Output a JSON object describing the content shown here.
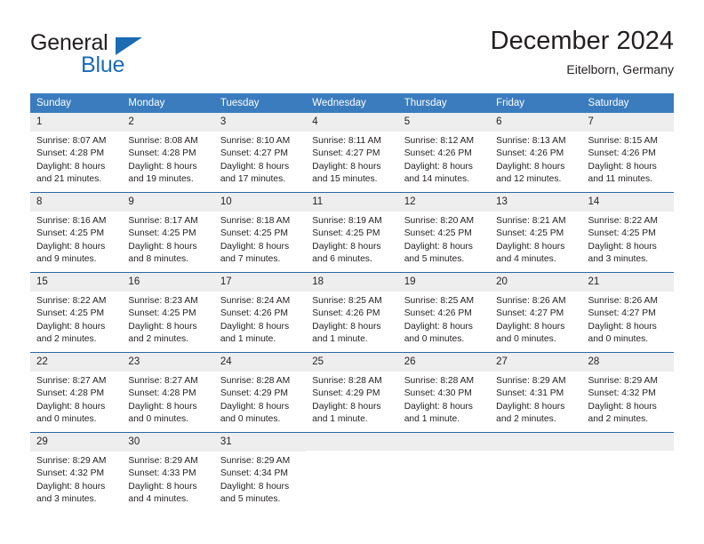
{
  "logo": {
    "word_top": "General",
    "word_bottom": "Blue",
    "triangle_icon": "triangle-icon",
    "brand_color": "#1b6cb3"
  },
  "header": {
    "title": "December 2024",
    "location": "Eitelborn, Germany"
  },
  "calendar": {
    "header_color": "#3a7cbe",
    "row_divider_color": "#2a69a8",
    "daynum_background": "#eeeeee",
    "weekday_headers": [
      "Sunday",
      "Monday",
      "Tuesday",
      "Wednesday",
      "Thursday",
      "Friday",
      "Saturday"
    ],
    "weeks": [
      [
        {
          "day": "1",
          "sunrise": "Sunrise: 8:07 AM",
          "sunset": "Sunset: 4:28 PM",
          "daylight_1": "Daylight: 8 hours",
          "daylight_2": "and 21 minutes."
        },
        {
          "day": "2",
          "sunrise": "Sunrise: 8:08 AM",
          "sunset": "Sunset: 4:28 PM",
          "daylight_1": "Daylight: 8 hours",
          "daylight_2": "and 19 minutes."
        },
        {
          "day": "3",
          "sunrise": "Sunrise: 8:10 AM",
          "sunset": "Sunset: 4:27 PM",
          "daylight_1": "Daylight: 8 hours",
          "daylight_2": "and 17 minutes."
        },
        {
          "day": "4",
          "sunrise": "Sunrise: 8:11 AM",
          "sunset": "Sunset: 4:27 PM",
          "daylight_1": "Daylight: 8 hours",
          "daylight_2": "and 15 minutes."
        },
        {
          "day": "5",
          "sunrise": "Sunrise: 8:12 AM",
          "sunset": "Sunset: 4:26 PM",
          "daylight_1": "Daylight: 8 hours",
          "daylight_2": "and 14 minutes."
        },
        {
          "day": "6",
          "sunrise": "Sunrise: 8:13 AM",
          "sunset": "Sunset: 4:26 PM",
          "daylight_1": "Daylight: 8 hours",
          "daylight_2": "and 12 minutes."
        },
        {
          "day": "7",
          "sunrise": "Sunrise: 8:15 AM",
          "sunset": "Sunset: 4:26 PM",
          "daylight_1": "Daylight: 8 hours",
          "daylight_2": "and 11 minutes."
        }
      ],
      [
        {
          "day": "8",
          "sunrise": "Sunrise: 8:16 AM",
          "sunset": "Sunset: 4:25 PM",
          "daylight_1": "Daylight: 8 hours",
          "daylight_2": "and 9 minutes."
        },
        {
          "day": "9",
          "sunrise": "Sunrise: 8:17 AM",
          "sunset": "Sunset: 4:25 PM",
          "daylight_1": "Daylight: 8 hours",
          "daylight_2": "and 8 minutes."
        },
        {
          "day": "10",
          "sunrise": "Sunrise: 8:18 AM",
          "sunset": "Sunset: 4:25 PM",
          "daylight_1": "Daylight: 8 hours",
          "daylight_2": "and 7 minutes."
        },
        {
          "day": "11",
          "sunrise": "Sunrise: 8:19 AM",
          "sunset": "Sunset: 4:25 PM",
          "daylight_1": "Daylight: 8 hours",
          "daylight_2": "and 6 minutes."
        },
        {
          "day": "12",
          "sunrise": "Sunrise: 8:20 AM",
          "sunset": "Sunset: 4:25 PM",
          "daylight_1": "Daylight: 8 hours",
          "daylight_2": "and 5 minutes."
        },
        {
          "day": "13",
          "sunrise": "Sunrise: 8:21 AM",
          "sunset": "Sunset: 4:25 PM",
          "daylight_1": "Daylight: 8 hours",
          "daylight_2": "and 4 minutes."
        },
        {
          "day": "14",
          "sunrise": "Sunrise: 8:22 AM",
          "sunset": "Sunset: 4:25 PM",
          "daylight_1": "Daylight: 8 hours",
          "daylight_2": "and 3 minutes."
        }
      ],
      [
        {
          "day": "15",
          "sunrise": "Sunrise: 8:22 AM",
          "sunset": "Sunset: 4:25 PM",
          "daylight_1": "Daylight: 8 hours",
          "daylight_2": "and 2 minutes."
        },
        {
          "day": "16",
          "sunrise": "Sunrise: 8:23 AM",
          "sunset": "Sunset: 4:25 PM",
          "daylight_1": "Daylight: 8 hours",
          "daylight_2": "and 2 minutes."
        },
        {
          "day": "17",
          "sunrise": "Sunrise: 8:24 AM",
          "sunset": "Sunset: 4:26 PM",
          "daylight_1": "Daylight: 8 hours",
          "daylight_2": "and 1 minute."
        },
        {
          "day": "18",
          "sunrise": "Sunrise: 8:25 AM",
          "sunset": "Sunset: 4:26 PM",
          "daylight_1": "Daylight: 8 hours",
          "daylight_2": "and 1 minute."
        },
        {
          "day": "19",
          "sunrise": "Sunrise: 8:25 AM",
          "sunset": "Sunset: 4:26 PM",
          "daylight_1": "Daylight: 8 hours",
          "daylight_2": "and 0 minutes."
        },
        {
          "day": "20",
          "sunrise": "Sunrise: 8:26 AM",
          "sunset": "Sunset: 4:27 PM",
          "daylight_1": "Daylight: 8 hours",
          "daylight_2": "and 0 minutes."
        },
        {
          "day": "21",
          "sunrise": "Sunrise: 8:26 AM",
          "sunset": "Sunset: 4:27 PM",
          "daylight_1": "Daylight: 8 hours",
          "daylight_2": "and 0 minutes."
        }
      ],
      [
        {
          "day": "22",
          "sunrise": "Sunrise: 8:27 AM",
          "sunset": "Sunset: 4:28 PM",
          "daylight_1": "Daylight: 8 hours",
          "daylight_2": "and 0 minutes."
        },
        {
          "day": "23",
          "sunrise": "Sunrise: 8:27 AM",
          "sunset": "Sunset: 4:28 PM",
          "daylight_1": "Daylight: 8 hours",
          "daylight_2": "and 0 minutes."
        },
        {
          "day": "24",
          "sunrise": "Sunrise: 8:28 AM",
          "sunset": "Sunset: 4:29 PM",
          "daylight_1": "Daylight: 8 hours",
          "daylight_2": "and 0 minutes."
        },
        {
          "day": "25",
          "sunrise": "Sunrise: 8:28 AM",
          "sunset": "Sunset: 4:29 PM",
          "daylight_1": "Daylight: 8 hours",
          "daylight_2": "and 1 minute."
        },
        {
          "day": "26",
          "sunrise": "Sunrise: 8:28 AM",
          "sunset": "Sunset: 4:30 PM",
          "daylight_1": "Daylight: 8 hours",
          "daylight_2": "and 1 minute."
        },
        {
          "day": "27",
          "sunrise": "Sunrise: 8:29 AM",
          "sunset": "Sunset: 4:31 PM",
          "daylight_1": "Daylight: 8 hours",
          "daylight_2": "and 2 minutes."
        },
        {
          "day": "28",
          "sunrise": "Sunrise: 8:29 AM",
          "sunset": "Sunset: 4:32 PM",
          "daylight_1": "Daylight: 8 hours",
          "daylight_2": "and 2 minutes."
        }
      ],
      [
        {
          "day": "29",
          "sunrise": "Sunrise: 8:29 AM",
          "sunset": "Sunset: 4:32 PM",
          "daylight_1": "Daylight: 8 hours",
          "daylight_2": "and 3 minutes."
        },
        {
          "day": "30",
          "sunrise": "Sunrise: 8:29 AM",
          "sunset": "Sunset: 4:33 PM",
          "daylight_1": "Daylight: 8 hours",
          "daylight_2": "and 4 minutes."
        },
        {
          "day": "31",
          "sunrise": "Sunrise: 8:29 AM",
          "sunset": "Sunset: 4:34 PM",
          "daylight_1": "Daylight: 8 hours",
          "daylight_2": "and 5 minutes."
        },
        {
          "day": "",
          "sunrise": "",
          "sunset": "",
          "daylight_1": "",
          "daylight_2": ""
        },
        {
          "day": "",
          "sunrise": "",
          "sunset": "",
          "daylight_1": "",
          "daylight_2": ""
        },
        {
          "day": "",
          "sunrise": "",
          "sunset": "",
          "daylight_1": "",
          "daylight_2": ""
        },
        {
          "day": "",
          "sunrise": "",
          "sunset": "",
          "daylight_1": "",
          "daylight_2": ""
        }
      ]
    ]
  }
}
